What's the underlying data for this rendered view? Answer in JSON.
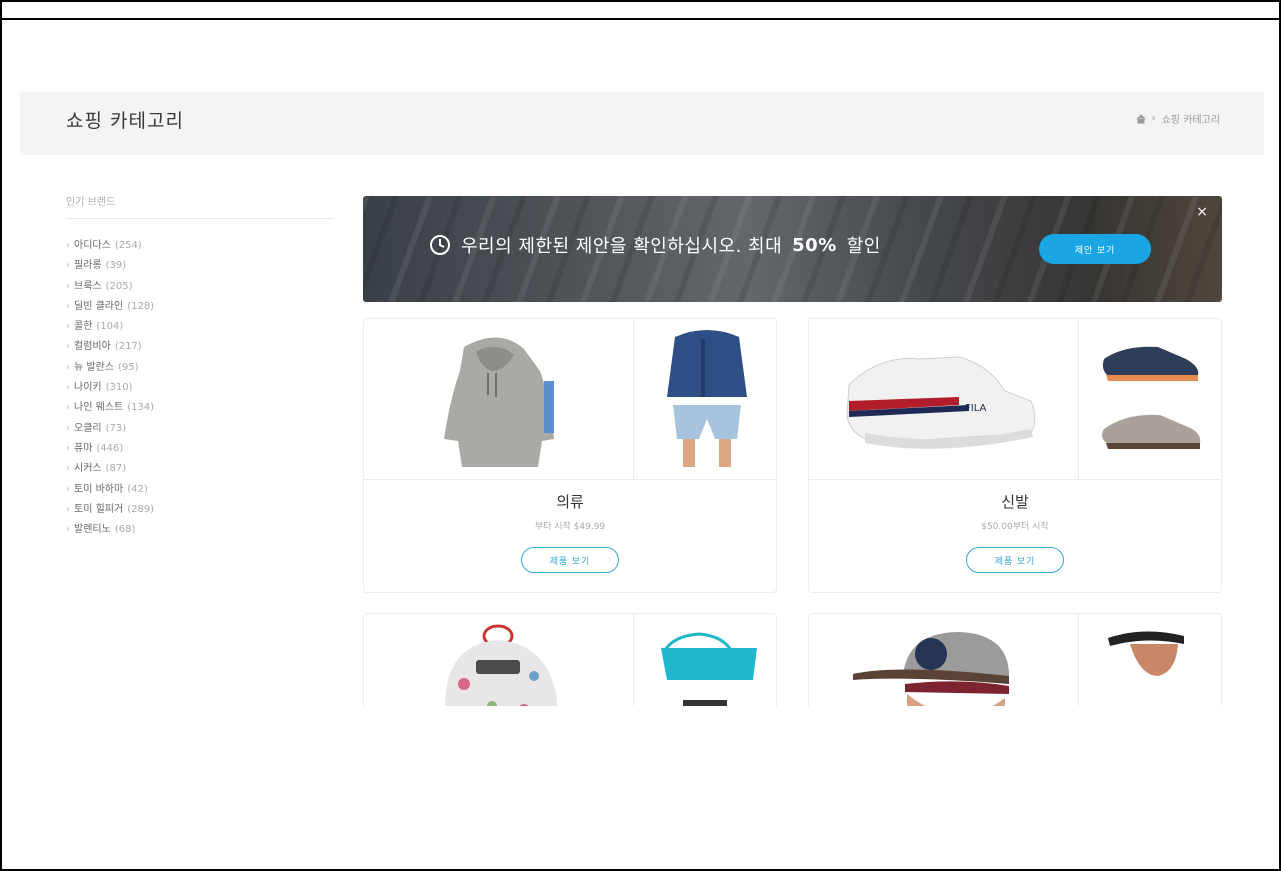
{
  "header": {
    "title": "쇼핑 카테고리",
    "breadcrumb": [
      "쇼핑 카테고리"
    ]
  },
  "sidebar": {
    "title": "인기 브랜드",
    "brands": [
      {
        "name": "아디다스",
        "count": "(254)"
      },
      {
        "name": "필라롱",
        "count": "(39)"
      },
      {
        "name": "브룩스",
        "count": "(205)"
      },
      {
        "name": "딜빈 클라인",
        "count": "(128)"
      },
      {
        "name": "콜한",
        "count": "(104)"
      },
      {
        "name": "컬럼비아",
        "count": "(217)"
      },
      {
        "name": "뉴 발란스",
        "count": "(95)"
      },
      {
        "name": "나이키",
        "count": "(310)"
      },
      {
        "name": "나인 웨스트",
        "count": "(134)"
      },
      {
        "name": "오클리",
        "count": "(73)"
      },
      {
        "name": "퓨마",
        "count": "(446)"
      },
      {
        "name": "시커스",
        "count": "(87)"
      },
      {
        "name": "토미 바하마",
        "count": "(42)"
      },
      {
        "name": "토미 힐피거",
        "count": "(289)"
      },
      {
        "name": "발렌티노",
        "count": "(68)"
      }
    ]
  },
  "banner": {
    "text_before": "우리의 제한된 제안을 확인하십시오. 최대",
    "highlight": "50%",
    "text_after": "할인",
    "button_label": "제안 보기",
    "close": "×"
  },
  "categories": [
    {
      "name": "의류",
      "price": "부터 시작 $49.99",
      "button": "제품 보기"
    },
    {
      "name": "신발",
      "price": "$50.00부터 시작",
      "button": "제품 보기"
    }
  ],
  "colors": {
    "accent": "#1aa6e5",
    "outline": "#35a9d8",
    "header_bg": "#f4f4f5"
  }
}
